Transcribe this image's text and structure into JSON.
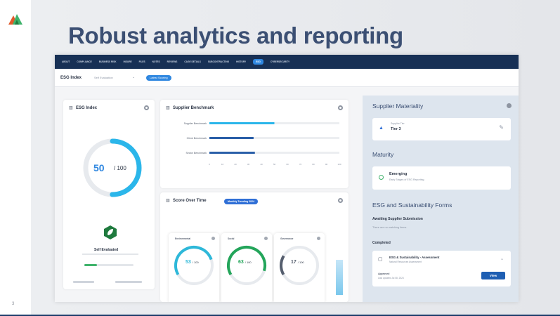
{
  "slide": {
    "title": "Robust analytics and reporting",
    "number": "3",
    "brand_colors": {
      "navy": "#173055",
      "blue": "#2f87e0",
      "green": "#3fb36b"
    }
  },
  "app": {
    "nav": {
      "items": [
        "About",
        "Compliance",
        "Business Risk",
        "Insure",
        "Files",
        "Notes",
        "Reviews",
        "Cage Details",
        "Subcontracting",
        "History",
        "ESG",
        "Cybersecurity"
      ],
      "active": "ESG"
    },
    "subheader": {
      "title": "ESG Index",
      "select_value": "Self Evaluation",
      "pill": "Latest Scoring"
    },
    "esg_card": {
      "title": "ESG Index",
      "score": "50",
      "max": "/ 100",
      "score_fraction": 0.5,
      "status": "Self Evaluated",
      "progress_fraction": 0.25
    },
    "benchmark_card": {
      "title": "Supplier Benchmark"
    },
    "score_card": {
      "title": "Score Over Time",
      "pill": "Monthly Trending 2024",
      "minis": [
        {
          "label": "Environmental",
          "value": "53",
          "max": "/ 100",
          "fraction": 0.53,
          "color": "#2eb8d9"
        },
        {
          "label": "Social",
          "value": "63",
          "max": "/ 100",
          "fraction": 0.63,
          "color": "#23a55a"
        },
        {
          "label": "Governance",
          "value": "17",
          "max": "/ 100",
          "fraction": 0.17,
          "color": "#555e6e"
        }
      ]
    },
    "right_panel": {
      "materiality_title": "Supplier Materiality",
      "tier_label": "Supplier Tier",
      "tier_value": "Tier 3",
      "maturity_title": "Maturity",
      "maturity_value": "Emerging",
      "maturity_sub": "Early Stages of ESG Reporting",
      "forms_title": "ESG and Sustainability Forms",
      "awaiting_label": "Awaiting Supplier Submission",
      "awaiting_empty": "There are no matching items.",
      "completed_label": "Completed",
      "form_title": "ESG & Sustainability - Assessment",
      "form_sub": "Natural Resources Assessment",
      "approved_label": "Approved",
      "approved_sub": "Last updated Jul 08, 2024",
      "view_button": "View"
    }
  },
  "chart_data": {
    "type": "bar",
    "categories": [
      "Supplier Benchmark",
      "Client Benchmark",
      "Sector Benchmark"
    ],
    "values": [
      50,
      34,
      35
    ],
    "xlim": [
      0,
      100
    ],
    "xticks": [
      "0",
      "10",
      "20",
      "30",
      "40",
      "50",
      "60",
      "70",
      "80",
      "90",
      "100"
    ]
  }
}
